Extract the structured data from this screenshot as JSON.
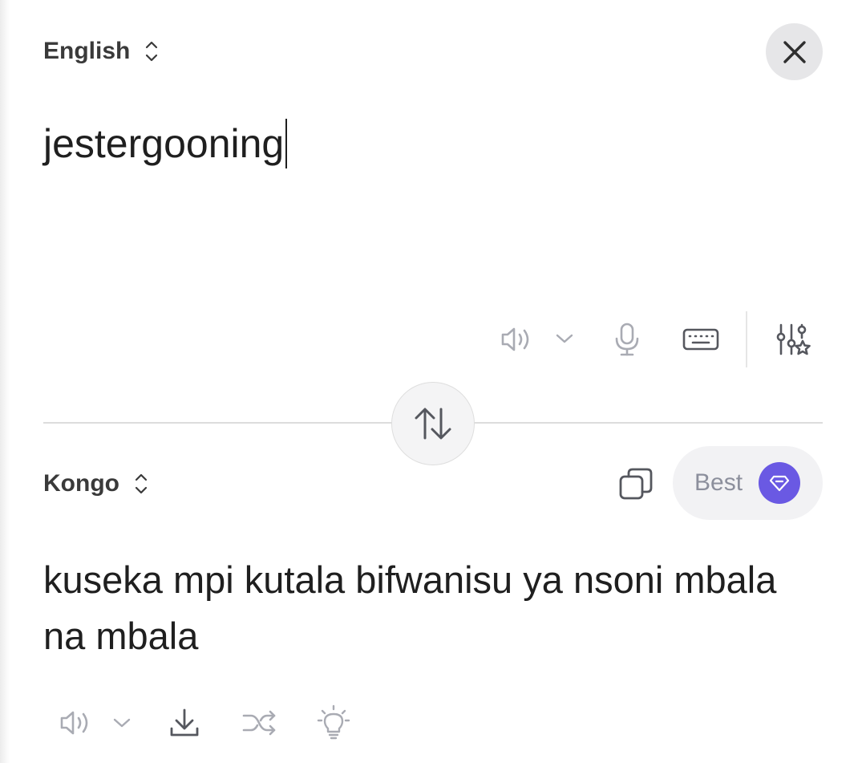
{
  "source": {
    "language": "English",
    "text": "jestergooning"
  },
  "target": {
    "language": "Kongo",
    "text": "kuseka mpi kutala bifwanisu ya nsoni mbala na mbala",
    "quality_label": "Best"
  },
  "icons": {
    "close": "close-icon",
    "speaker": "speaker-icon",
    "chevron": "chevron-down-icon",
    "microphone": "microphone-icon",
    "keyboard": "keyboard-icon",
    "settings": "sliders-star-icon",
    "swap": "swap-arrows-icon",
    "copy": "copy-icon",
    "gem": "gem-icon",
    "download": "download-icon",
    "shuffle": "shuffle-icon",
    "idea": "lightbulb-icon"
  },
  "colors": {
    "accent": "#6a59e3",
    "icon_muted": "#a9abb3",
    "icon_dark": "#55575e"
  }
}
